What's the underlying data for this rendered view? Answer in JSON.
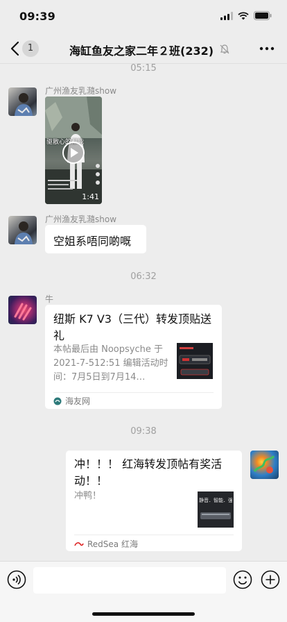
{
  "status_bar": {
    "time": "09:39"
  },
  "header": {
    "back_label": "<",
    "unread_count": "1",
    "title": "海缸鱼友之家二年２班(232)",
    "more_icon": "more-icon",
    "mute_icon": "mute-bell-icon"
  },
  "messages": [
    {
      "time": "05:15"
    },
    {
      "sender": "广州渔友乳瀡show",
      "type": "video",
      "duration": "1:41",
      "video_caption": "驱散心的都能"
    },
    {
      "sender": "广州渔友乳瀡show",
      "type": "text",
      "text": "空姐系唔同啲嘅"
    },
    {
      "time": "06:32"
    },
    {
      "sender": "牛",
      "type": "link",
      "title": "纽斯 K7 V3（三代）转发顶贴送礼",
      "description": "本帖最后由 Noopsyche 于 2021-7-512:51 编辑活动时间：7月5日到7月14…",
      "source": "海友网"
    },
    {
      "time": "09:38"
    },
    {
      "type": "link",
      "outgoing": true,
      "title": "冲！！！ 红海转发顶帖有奖活动！！",
      "description": "冲鸭！",
      "source": "RedSea 红海",
      "thumb_caption": "静音．智能．强劲"
    }
  ],
  "colors": {
    "bg": "#ededed",
    "bubble": "#ffffff",
    "meta": "#a0a0a0"
  }
}
